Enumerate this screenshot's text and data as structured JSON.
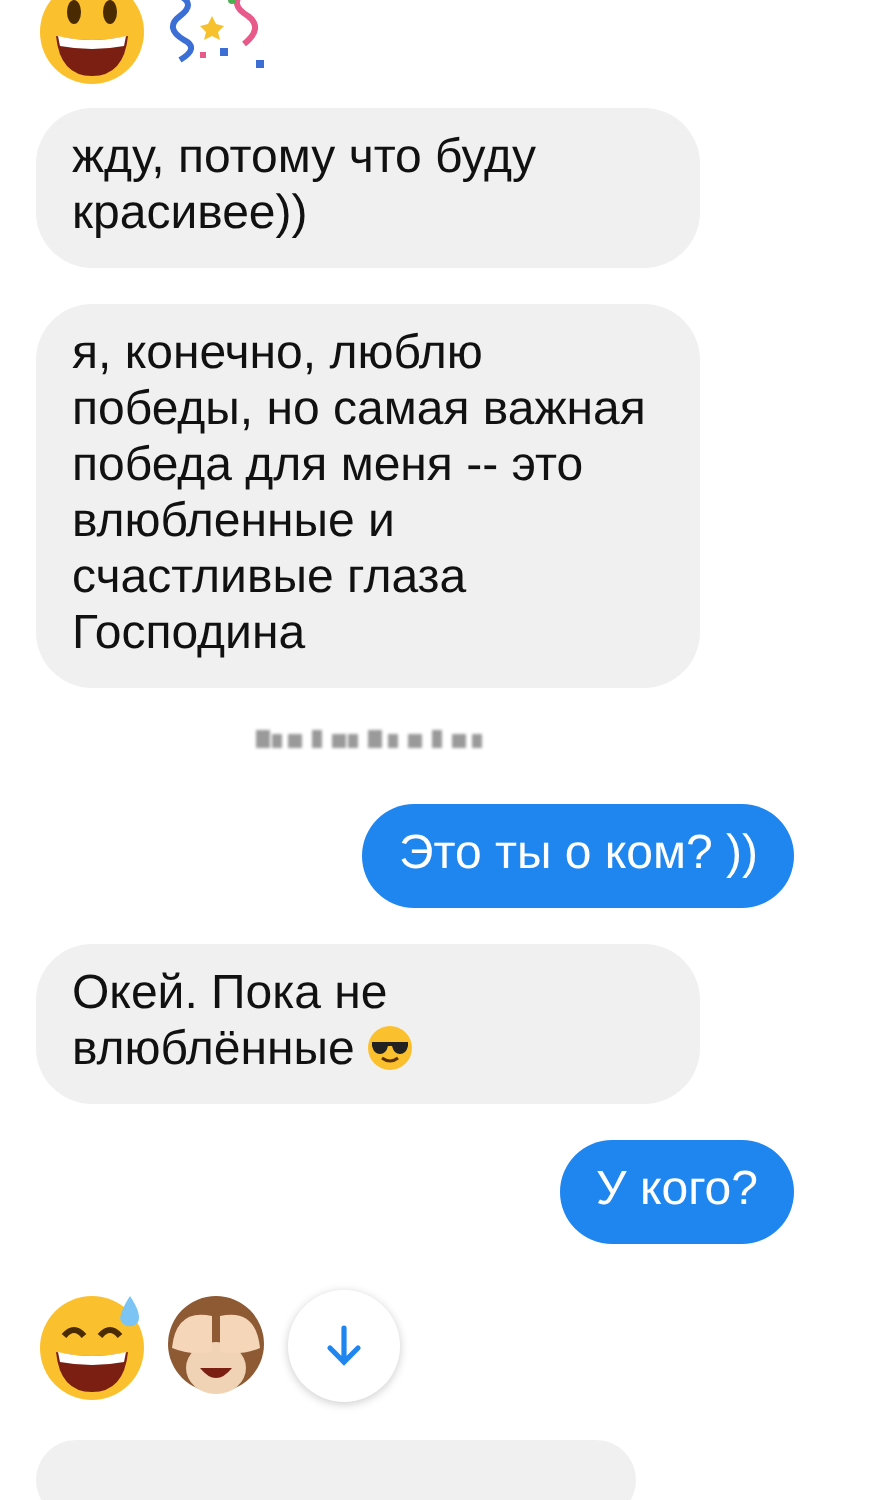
{
  "messages": [
    {
      "kind": "emoji_row",
      "with_scroll_button": false
    },
    {
      "kind": "incoming",
      "text": "жду, потому что буду красивее))"
    },
    {
      "kind": "incoming",
      "text": "я, конечно, люблю победы, но самая важная победа для меня -- это влюбленные и счастливые глаза Господина"
    },
    {
      "kind": "timestamp"
    },
    {
      "kind": "outgoing",
      "text": "Это ты о ком? ))"
    },
    {
      "kind": "incoming",
      "text": "Окей. Пока не влюблённые",
      "trailing_emoji": true
    },
    {
      "kind": "outgoing",
      "text": "У кого?"
    },
    {
      "kind": "emoji_row",
      "with_scroll_button": true
    },
    {
      "kind": "incoming_partial"
    }
  ]
}
